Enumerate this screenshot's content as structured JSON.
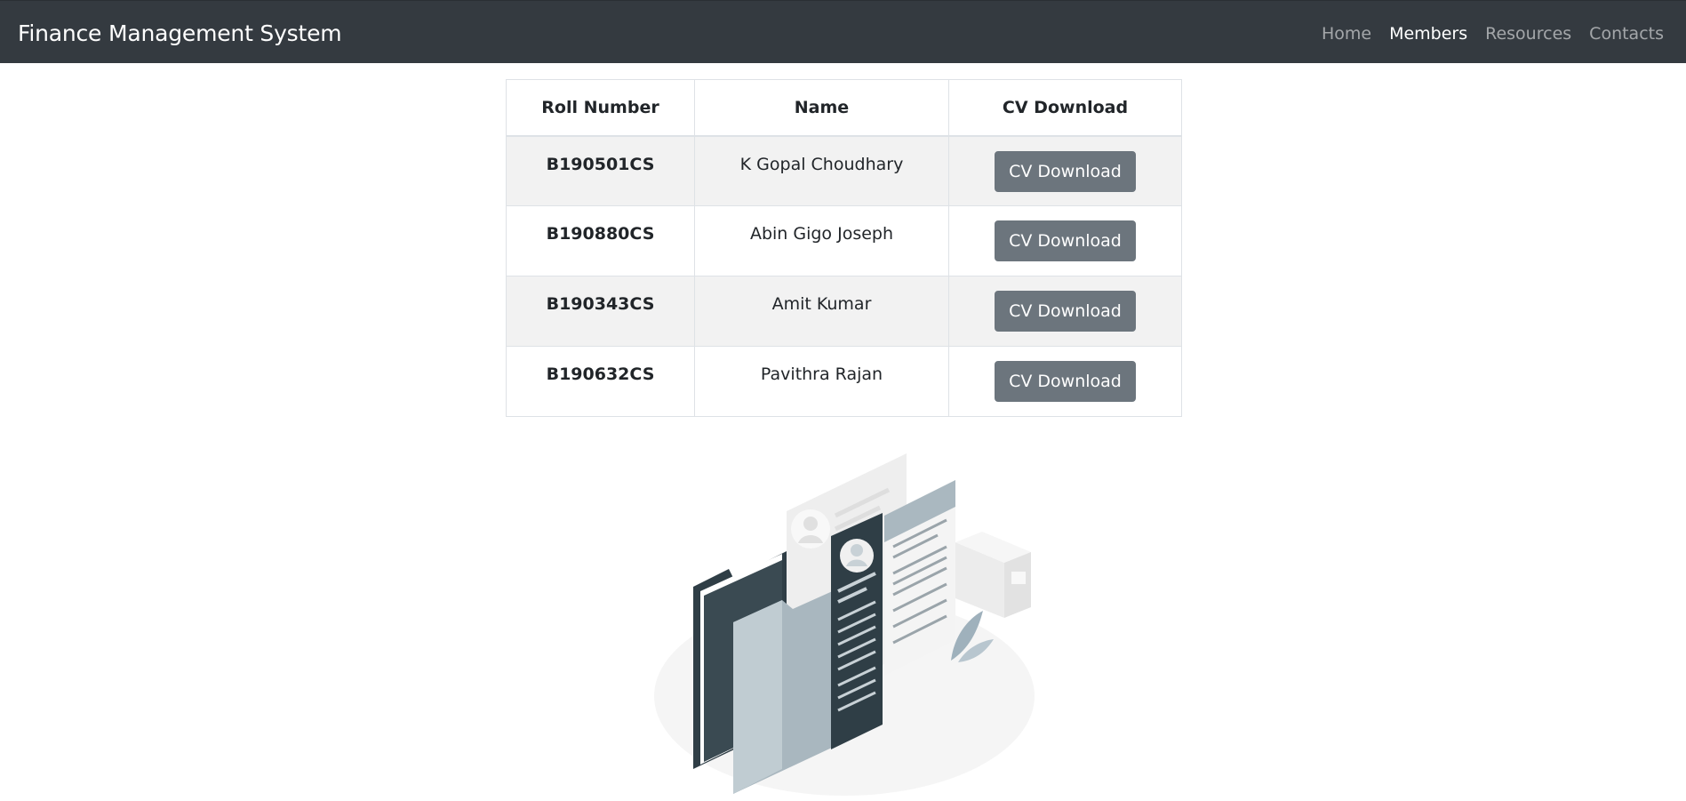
{
  "navbar": {
    "brand": "Finance Management System",
    "links": [
      {
        "label": "Home",
        "active": false
      },
      {
        "label": "Members",
        "active": true
      },
      {
        "label": "Resources",
        "active": false
      },
      {
        "label": "Contacts",
        "active": false
      }
    ]
  },
  "table": {
    "headers": [
      "Roll Number",
      "Name",
      "CV Download"
    ],
    "rows": [
      {
        "roll": "B190501CS",
        "name": "K Gopal Choudhary",
        "button": "CV Download"
      },
      {
        "roll": "B190880CS",
        "name": "Abin Gigo Joseph",
        "button": "CV Download"
      },
      {
        "roll": "B190343CS",
        "name": "Amit Kumar",
        "button": "CV Download"
      },
      {
        "roll": "B190632CS",
        "name": "Pavithra Rajan",
        "button": "CV Download"
      }
    ]
  },
  "illustration": {
    "icon": "resume-documents-illustration"
  },
  "colors": {
    "navbar": "#343a40",
    "button": "#6c757d",
    "stripe": "#f2f2f2",
    "border": "#dee2e6"
  }
}
